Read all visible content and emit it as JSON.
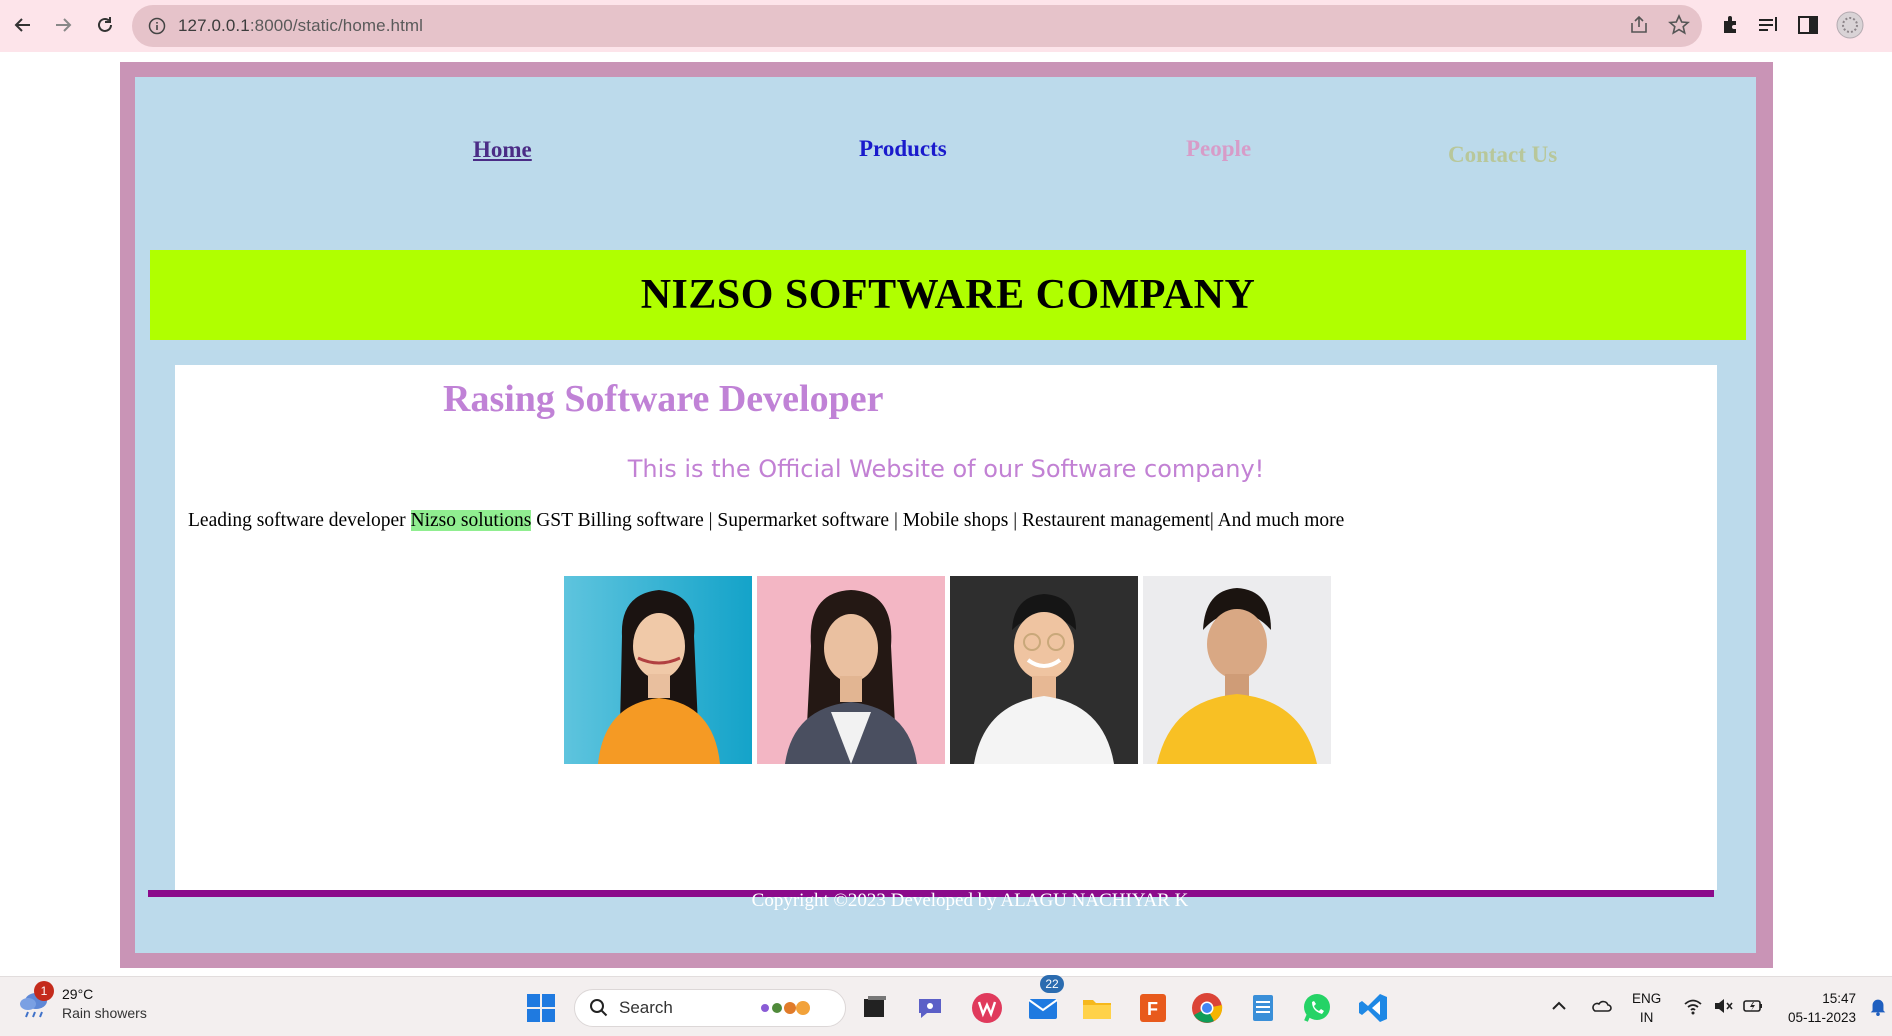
{
  "browser": {
    "url_host": "127.0.0.1",
    "url_path": ":8000/static/home.html"
  },
  "nav": {
    "home": "Home",
    "products": "Products",
    "people": "People",
    "contact": "Contact Us"
  },
  "banner": {
    "title": "NIZSO SOFTWARE COMPANY"
  },
  "content": {
    "heading": "Rasing Software Developer",
    "subtitle": "This is the Official Website of our Software company!",
    "lead_before": "Leading software developer ",
    "lead_highlight": "Nizso solutions",
    "lead_after": " GST Billing software | Supermarket software | Mobile shops | Restaurent management| And much more"
  },
  "footer": {
    "text": "Copyright ©2023 Developed by ALAGU NACHIYAR K"
  },
  "taskbar": {
    "weather_badge": "1",
    "temperature": "29°C",
    "condition": "Rain showers",
    "search_label": "Search",
    "mail_badge": "22",
    "lang_top": "ENG",
    "lang_bottom": "IN",
    "time": "15:47",
    "date": "05-11-2023"
  },
  "colors": {
    "outer_border": "#c994b6",
    "page_bg": "#bcdaeb",
    "banner_bg": "#b0ff00",
    "heading": "#c082d6",
    "footer_line": "#8b0a8b"
  }
}
